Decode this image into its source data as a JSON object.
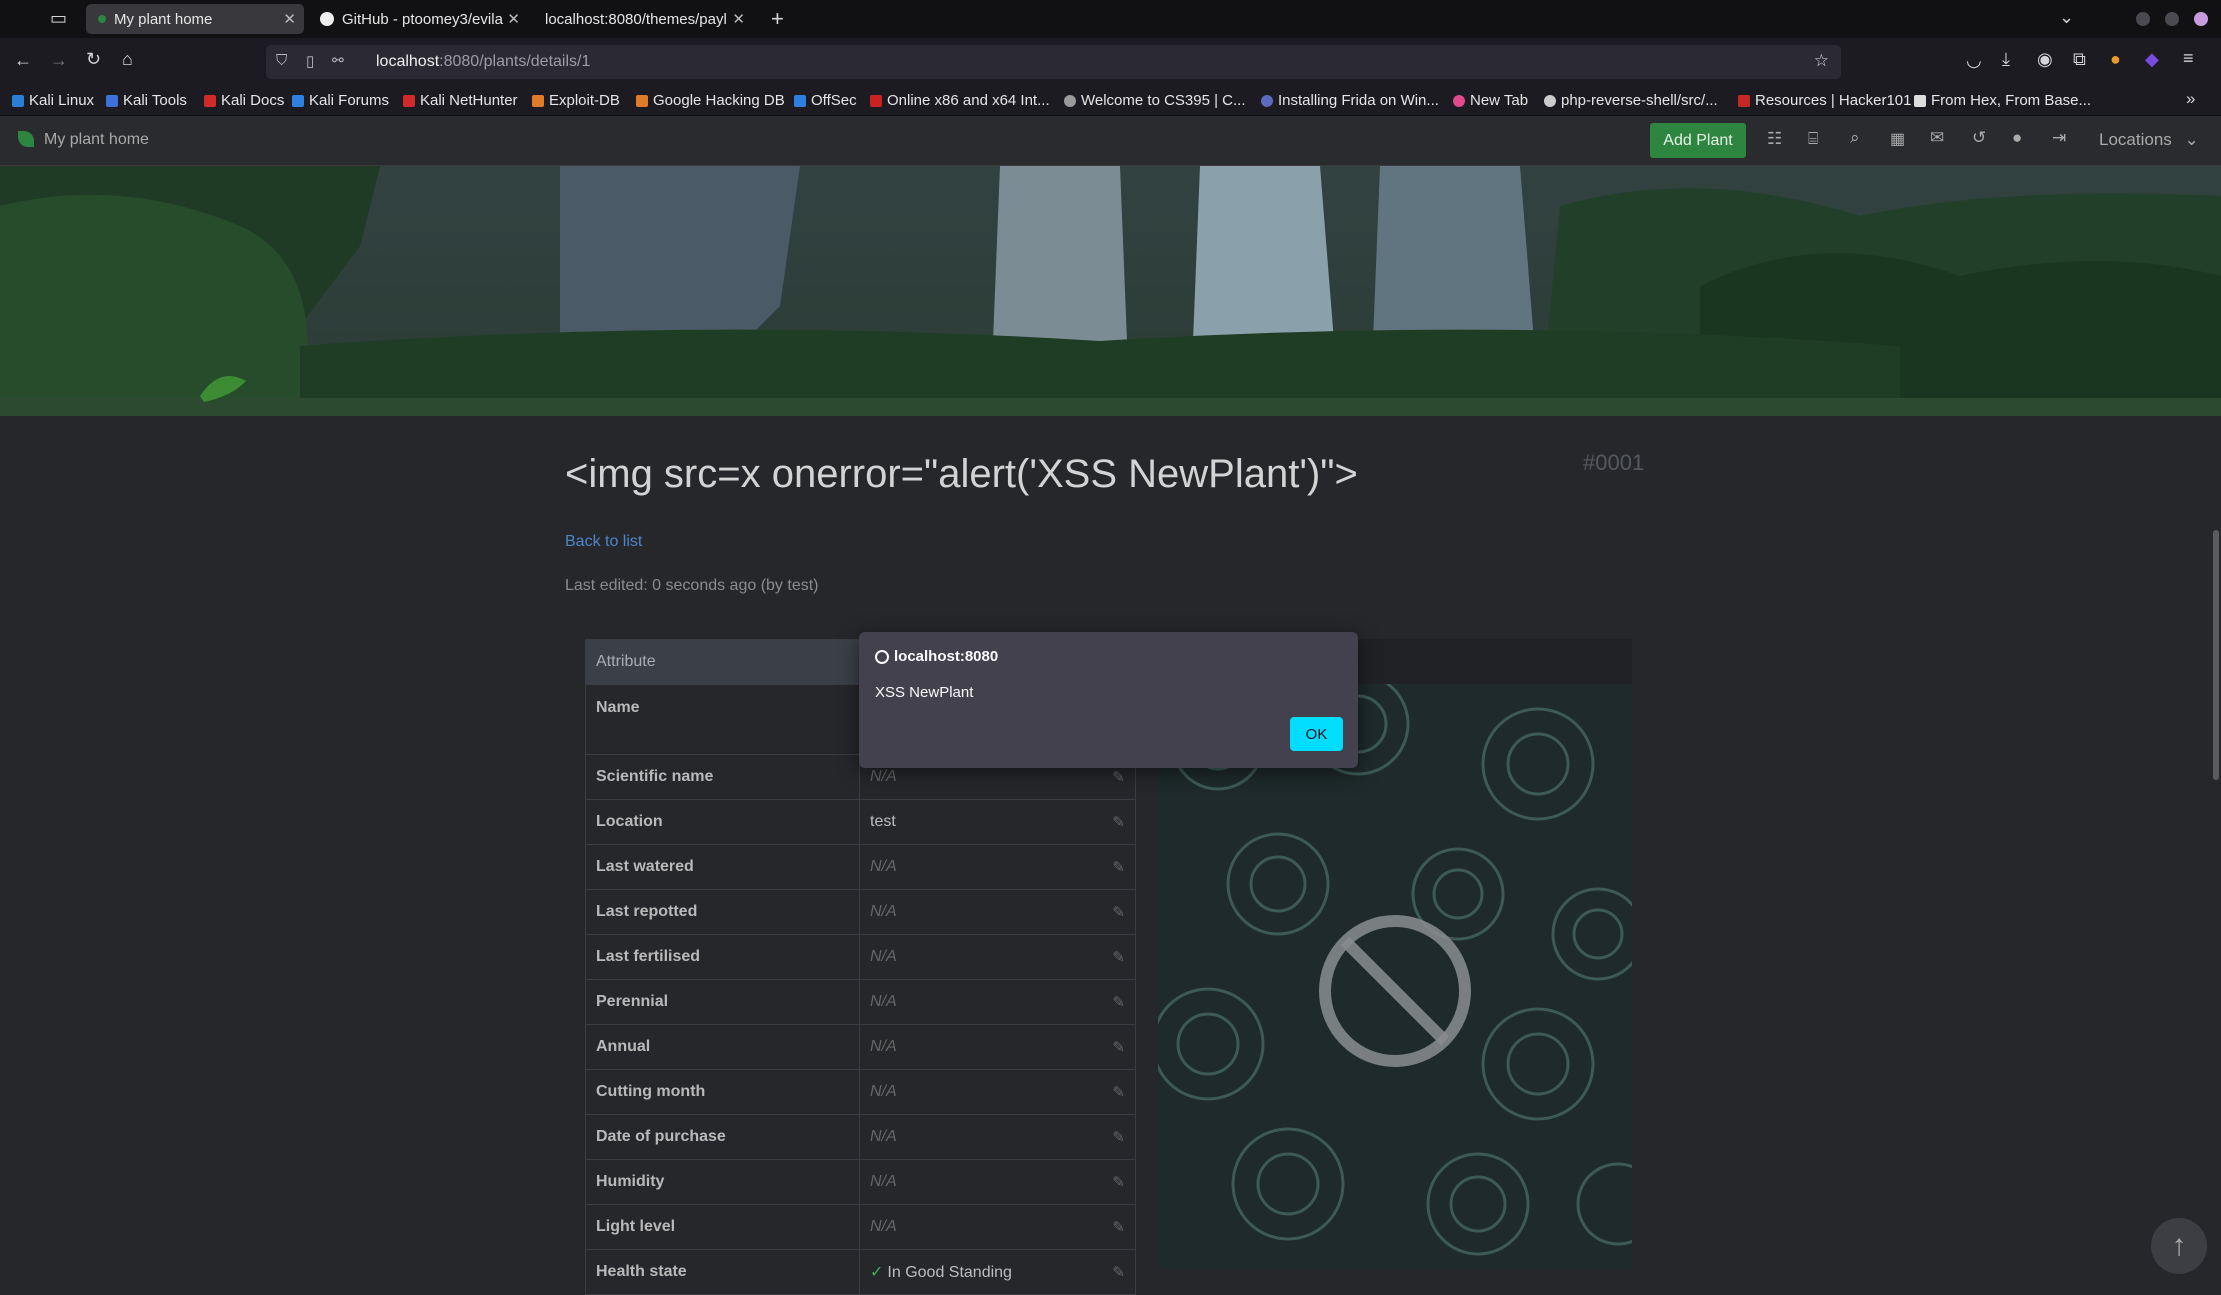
{
  "browser": {
    "tabs": [
      {
        "label": "My plant home"
      },
      {
        "label": "GitHub - ptoomey3/evila"
      },
      {
        "label": "localhost:8080/themes/payl"
      }
    ],
    "url_host": "localhost",
    "url_rest": ":8080/plants/details/1",
    "bookmarks": [
      {
        "label": "Kali Linux",
        "color": "#2a7fd4"
      },
      {
        "label": "Kali Tools",
        "color": "#3f6fd8"
      },
      {
        "label": "Kali Docs",
        "color": "#d12a2a"
      },
      {
        "label": "Kali Forums",
        "color": "#2f7fe0"
      },
      {
        "label": "Kali NetHunter",
        "color": "#d12a2a"
      },
      {
        "label": "Exploit-DB",
        "color": "#e07b2a"
      },
      {
        "label": "Google Hacking DB",
        "color": "#e07b2a"
      },
      {
        "label": "OffSec",
        "color": "#2f7fe0"
      },
      {
        "label": "Online x86 and x64 Int...",
        "color": "#c82222"
      },
      {
        "label": "Welcome to CS395 | C...",
        "color": "#9a9a9a"
      },
      {
        "label": "Installing Frida on Win...",
        "color": "#5c6bc0"
      },
      {
        "label": "New Tab",
        "color": "#e04a8a"
      },
      {
        "label": "php-reverse-shell/src/...",
        "color": "#cccccc"
      },
      {
        "label": "Resources | Hacker101",
        "color": "#c62828"
      },
      {
        "label": "From Hex, From Base...",
        "color": "#dddddd"
      }
    ]
  },
  "app": {
    "brand": "My plant home",
    "add_plant": "Add Plant",
    "locations": "Locations",
    "accent": "#2e8540"
  },
  "plant": {
    "title": "<img src=x onerror=\"alert('XSS NewPlant')\">",
    "id": "#0001",
    "back_link": "Back to list",
    "last_edited": "Last edited: 0 seconds ago (by test)",
    "table_header": "Attribute",
    "rows": [
      {
        "key": "Name",
        "value": ""
      },
      {
        "key": "Scientific name",
        "value": "N/A"
      },
      {
        "key": "Location",
        "value": "test"
      },
      {
        "key": "Last watered",
        "value": "N/A"
      },
      {
        "key": "Last repotted",
        "value": "N/A"
      },
      {
        "key": "Last fertilised",
        "value": "N/A"
      },
      {
        "key": "Perennial",
        "value": "N/A"
      },
      {
        "key": "Annual",
        "value": "N/A"
      },
      {
        "key": "Cutting month",
        "value": "N/A"
      },
      {
        "key": "Date of purchase",
        "value": "N/A"
      },
      {
        "key": "Humidity",
        "value": "N/A"
      },
      {
        "key": "Light level",
        "value": "N/A"
      },
      {
        "key": "Health state",
        "value": "In Good Standing"
      }
    ]
  },
  "dialog": {
    "host": "localhost:8080",
    "message": "XSS NewPlant",
    "ok": "OK"
  }
}
